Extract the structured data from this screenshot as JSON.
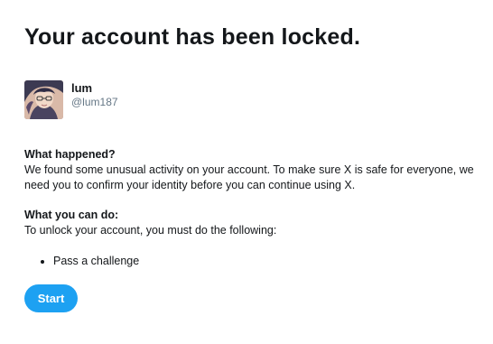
{
  "page": {
    "title": "Your account has been locked."
  },
  "user": {
    "name": "lum",
    "handle": "@lum187",
    "avatar_icon": "user-avatar-image"
  },
  "sections": [
    {
      "heading": "What happened?",
      "text": "We found some unusual activity on your account. To make sure X is safe for everyone, we need you to confirm your identity before you can continue using X."
    },
    {
      "heading": "What you can do:",
      "text": "To unlock your account, you must do the following:"
    }
  ],
  "steps": [
    "Pass a challenge"
  ],
  "actions": {
    "start_label": "Start"
  },
  "colors": {
    "accent": "#1da1f2",
    "text": "#14171a",
    "muted": "#657786"
  }
}
